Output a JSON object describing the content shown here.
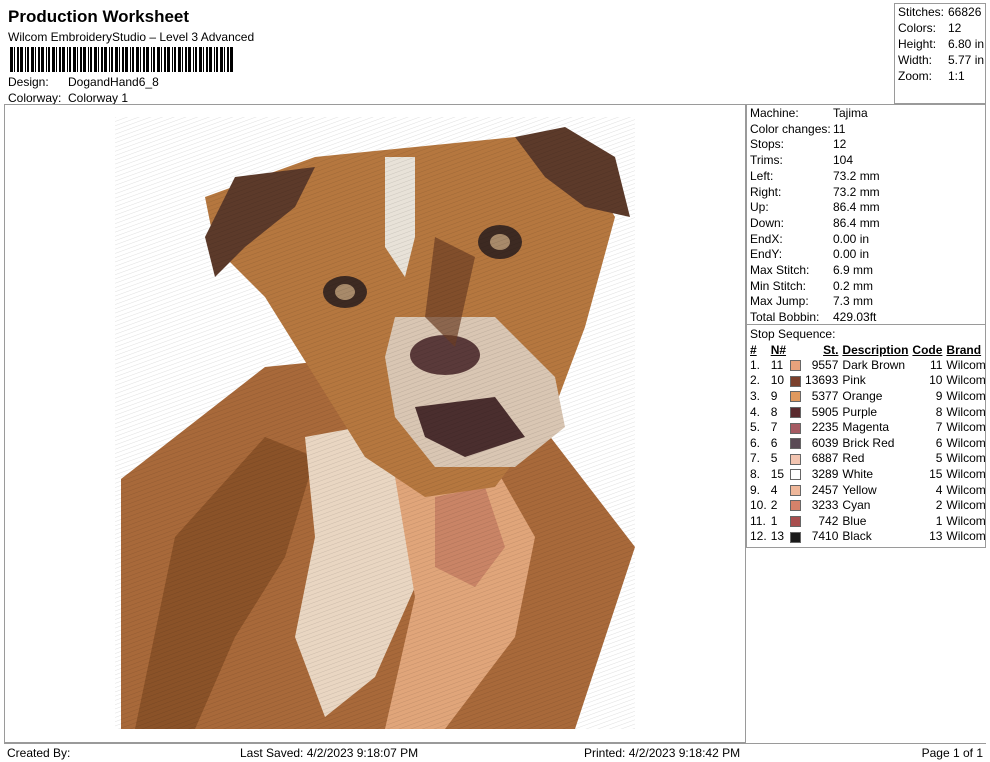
{
  "header": {
    "title": "Production Worksheet",
    "subtitle": "Wilcom EmbroideryStudio – Level 3 Advanced",
    "design_label": "Design:",
    "design_value": "DogandHand6_8",
    "colorway_label": "Colorway:",
    "colorway_value": "Colorway 1"
  },
  "summary": {
    "stitches_label": "Stitches:",
    "stitches": "66826",
    "colors_label": "Colors:",
    "colors": "12",
    "height_label": "Height:",
    "height": "6.80 in",
    "width_label": "Width:",
    "width": "5.77 in",
    "zoom_label": "Zoom:",
    "zoom": "1:1"
  },
  "params": [
    {
      "label": "Machine:",
      "value": "Tajima"
    },
    {
      "label": "Color changes:",
      "value": "11"
    },
    {
      "label": "Stops:",
      "value": "12"
    },
    {
      "label": "Trims:",
      "value": "104"
    },
    {
      "label": "Left:",
      "value": "73.2 mm"
    },
    {
      "label": "Right:",
      "value": "73.2 mm"
    },
    {
      "label": "Up:",
      "value": "86.4 mm"
    },
    {
      "label": "Down:",
      "value": "86.4 mm"
    },
    {
      "label": "EndX:",
      "value": "0.00 in"
    },
    {
      "label": "EndY:",
      "value": "0.00 in"
    },
    {
      "label": "Max Stitch:",
      "value": "6.9 mm"
    },
    {
      "label": "Min Stitch:",
      "value": "0.2 mm"
    },
    {
      "label": "Max Jump:",
      "value": "7.3 mm"
    },
    {
      "label": "Total Bobbin:",
      "value": "429.03ft"
    }
  ],
  "stop_sequence": {
    "caption": "Stop Sequence:",
    "headers": [
      "#",
      "N#",
      "St.",
      "Description",
      "Code",
      "Brand"
    ],
    "rows": [
      {
        "num": "1.",
        "n": "11",
        "color": "#e8a27c",
        "st": "9557",
        "desc": "Dark Brown",
        "code": "11",
        "brand": "Wilcom"
      },
      {
        "num": "2.",
        "n": "10",
        "color": "#7a3f2b",
        "st": "13693",
        "desc": "Pink",
        "code": "10",
        "brand": "Wilcom"
      },
      {
        "num": "3.",
        "n": "9",
        "color": "#e0995e",
        "st": "5377",
        "desc": "Orange",
        "code": "9",
        "brand": "Wilcom"
      },
      {
        "num": "4.",
        "n": "8",
        "color": "#5a2a2e",
        "st": "5905",
        "desc": "Purple",
        "code": "8",
        "brand": "Wilcom"
      },
      {
        "num": "5.",
        "n": "7",
        "color": "#a55a62",
        "st": "2235",
        "desc": "Magenta",
        "code": "7",
        "brand": "Wilcom"
      },
      {
        "num": "6.",
        "n": "6",
        "color": "#5a4a55",
        "st": "6039",
        "desc": "Brick Red",
        "code": "6",
        "brand": "Wilcom"
      },
      {
        "num": "7.",
        "n": "5",
        "color": "#f2c4b0",
        "st": "6887",
        "desc": "Red",
        "code": "5",
        "brand": "Wilcom"
      },
      {
        "num": "8.",
        "n": "15",
        "color": "#ffffff",
        "st": "3289",
        "desc": "White",
        "code": "15",
        "brand": "Wilcom"
      },
      {
        "num": "9.",
        "n": "4",
        "color": "#efb79a",
        "st": "2457",
        "desc": "Yellow",
        "code": "4",
        "brand": "Wilcom"
      },
      {
        "num": "10.",
        "n": "2",
        "color": "#d6826a",
        "st": "3233",
        "desc": "Cyan",
        "code": "2",
        "brand": "Wilcom"
      },
      {
        "num": "11.",
        "n": "1",
        "color": "#a84e4e",
        "st": "742",
        "desc": "Blue",
        "code": "1",
        "brand": "Wilcom"
      },
      {
        "num": "12.",
        "n": "13",
        "color": "#1a1a1a",
        "st": "7410",
        "desc": "Black",
        "code": "13",
        "brand": "Wilcom"
      }
    ]
  },
  "footer": {
    "created_by": "Created By:",
    "last_saved": "Last Saved: 4/2/2023 9:18:07 PM",
    "printed": "Printed: 4/2/2023 9:18:42 PM",
    "page": "Page 1 of 1"
  }
}
